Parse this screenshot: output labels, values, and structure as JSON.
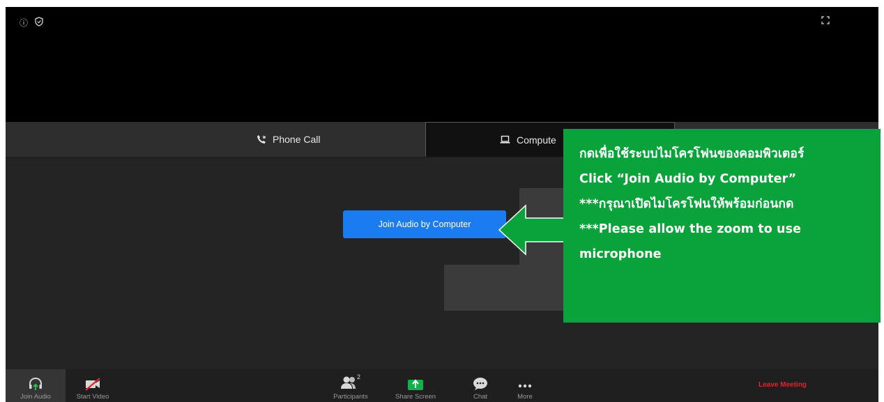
{
  "tabs": [
    {
      "label": "Phone Call",
      "icon": "phone-icon"
    },
    {
      "label": "Compute",
      "icon": "laptop-icon"
    }
  ],
  "join_button": {
    "label": "Join Audio by Computer"
  },
  "toolbar": {
    "join_audio": "Join Audio",
    "start_video": "Start Video",
    "participants": "Participants",
    "participants_count": "2",
    "share_screen": "Share Screen",
    "chat": "Chat",
    "more": "More",
    "leave": "Leave Meeting"
  },
  "callout": {
    "line1": "กดเพื่อใช้ระบบไมโครโฟนของคอมพิวเตอร์",
    "line2": "Click “Join Audio by Computer”",
    "line3": "***กรุณาเปิดไมโครโฟนให้พร้อมก่อนกด",
    "line4": "***Please allow the zoom to use",
    "line5": "microphone"
  },
  "colors": {
    "join_blue": "#1b7bf0",
    "callout_green": "#0aa23a",
    "leave_red": "#e0242a",
    "share_green": "#10b14b"
  }
}
